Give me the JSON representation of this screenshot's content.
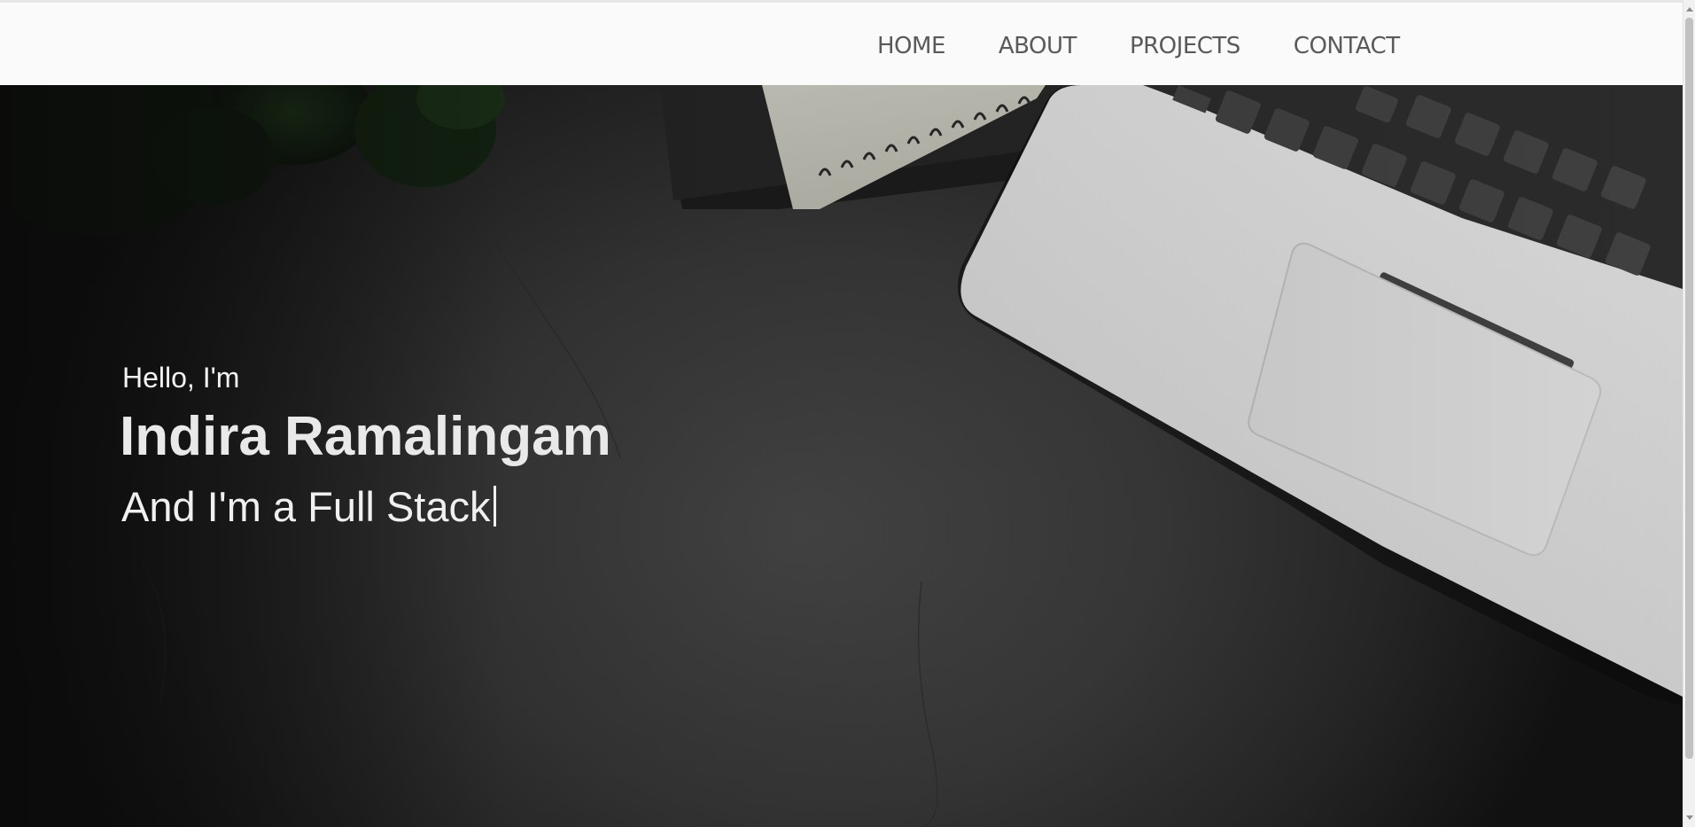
{
  "nav": {
    "items": [
      {
        "label": "HOME"
      },
      {
        "label": "ABOUT"
      },
      {
        "label": "PROJECTS"
      },
      {
        "label": "CONTACT"
      }
    ]
  },
  "hero": {
    "greeting": "Hello, I'm",
    "name": "Indira Ramalingam",
    "role_text": "And I'm a Full Stack",
    "background_image": "desk-laptop-notebook-plant-photo"
  },
  "colors": {
    "navbar_bg": "#fafafa",
    "nav_text": "#5a5a5a",
    "hero_text": "#f3f3f3",
    "hero_bg_dark": "#262626"
  }
}
